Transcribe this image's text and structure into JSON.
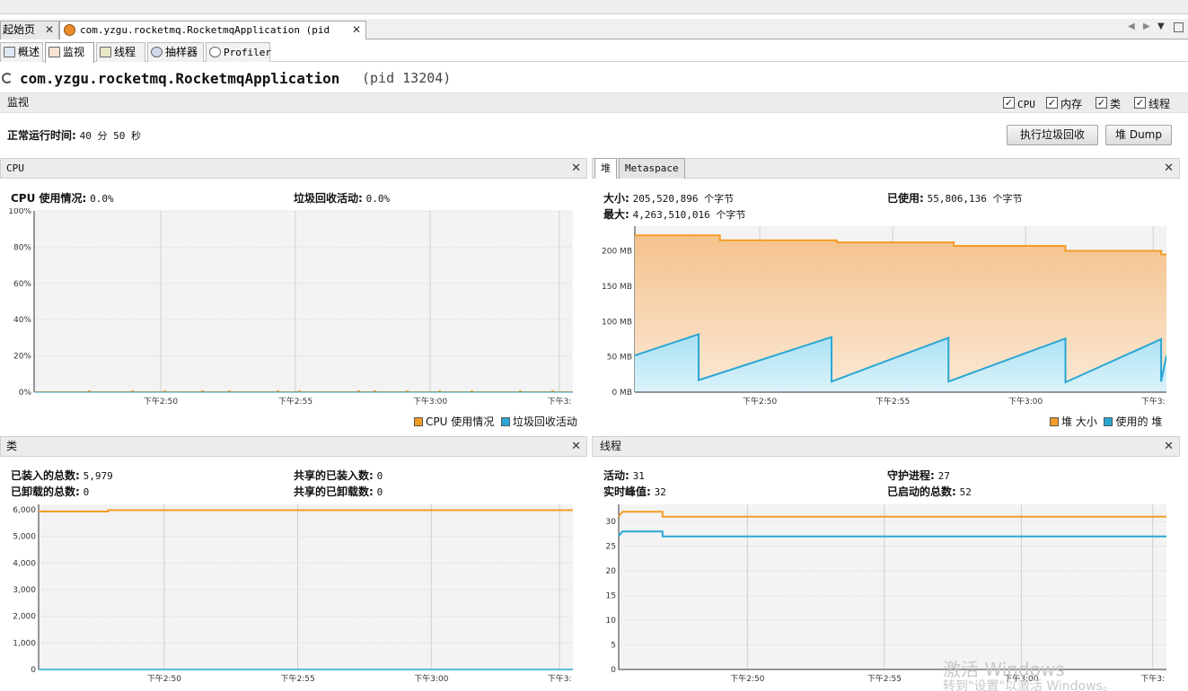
{
  "doc_tabs": [
    {
      "label": "起始页"
    },
    {
      "label": "com.yzgu.rocketmq.RocketmqApplication (pid 13204)"
    }
  ],
  "sub_tabs": [
    {
      "label": "概述"
    },
    {
      "label": "监视"
    },
    {
      "label": "线程"
    },
    {
      "label": "抽样器"
    },
    {
      "label": "Profiler"
    }
  ],
  "page_title": {
    "name": "com.yzgu.rocketmq.RocketmqApplication",
    "pid": "(pid 13204)"
  },
  "monitor": {
    "section_label": "监视",
    "checks": [
      {
        "label": "CPU",
        "checked": true
      },
      {
        "label": "内存",
        "checked": true
      },
      {
        "label": "类",
        "checked": true
      },
      {
        "label": "线程",
        "checked": true
      }
    ],
    "uptime_label": "正常运行时间:",
    "uptime_value": "40 分 50 秒",
    "gc_button": "执行垃圾回收",
    "dump_button": "堆 Dump"
  },
  "cpu_panel": {
    "title": "CPU",
    "usage_label": "CPU 使用情况:",
    "usage_value": "0.0%",
    "gc_label": "垃圾回收活动:",
    "gc_value": "0.0%",
    "legend": [
      "CPU 使用情况",
      "垃圾回收活动"
    ]
  },
  "heap_panel": {
    "tabs": [
      "堆",
      "Metaspace"
    ],
    "size_label": "大小:",
    "size_value": "205,520,896 个字节",
    "max_label": "最大:",
    "max_value": "4,263,510,016 个字节",
    "used_label": "已使用:",
    "used_value": "55,806,136 个字节",
    "legend": [
      "堆 大小",
      "使用的 堆"
    ]
  },
  "class_panel": {
    "title": "类",
    "loaded_label": "已装入的总数:",
    "loaded_value": "5,979",
    "unloaded_label": "已卸载的总数:",
    "unloaded_value": "0",
    "shared_loaded_label": "共享的已装入数:",
    "shared_loaded_value": "0",
    "shared_unloaded_label": "共享的已卸载数:",
    "shared_unloaded_value": "0"
  },
  "thread_panel": {
    "title": "线程",
    "live_label": "活动:",
    "live_value": "31",
    "peak_label": "实时峰值:",
    "peak_value": "32",
    "daemon_label": "守护进程:",
    "daemon_value": "27",
    "started_label": "已启动的总数:",
    "started_value": "52"
  },
  "watermark": {
    "line1": "激活 Windows",
    "line2": "转到\"设置\"以激活 Windows。"
  },
  "colors": {
    "orange": "#f39c26",
    "blue": "#2aa7d4",
    "grid": "#c8c8c8"
  },
  "chart_data": [
    {
      "type": "line",
      "name": "cpu",
      "ylim": [
        0,
        100
      ],
      "yticks": [
        "0%",
        "20%",
        "40%",
        "60%",
        "80%",
        "100%"
      ],
      "ytick_values": [
        0,
        20,
        40,
        60,
        80,
        100
      ],
      "x": [
        "下午2:50",
        "下午2:55",
        "下午3:00",
        "下午3:"
      ],
      "series": [
        {
          "name": "CPU 使用情况",
          "color": "#f39c26",
          "values": [
            0,
            0,
            0,
            0
          ]
        },
        {
          "name": "垃圾回收活动",
          "color": "#2aa7d4",
          "values": [
            0,
            0,
            0,
            0
          ]
        }
      ]
    },
    {
      "type": "area",
      "name": "heap",
      "ylim": [
        0,
        235
      ],
      "yticks": [
        "0 MB",
        "50 MB",
        "100 MB",
        "150 MB",
        "200 MB"
      ],
      "ytick_values": [
        0,
        50,
        100,
        150,
        200
      ],
      "x": [
        "下午2:50",
        "下午2:55",
        "下午3:00",
        "下午3:"
      ],
      "series": [
        {
          "name": "堆 大小",
          "color": "#f39c26",
          "steps": [
            [
              0,
              222
            ],
            [
              0.16,
              215
            ],
            [
              0.38,
              212
            ],
            [
              0.6,
              207
            ],
            [
              0.81,
              200
            ],
            [
              0.99,
              195
            ]
          ]
        },
        {
          "name": "使用的 堆",
          "color": "#2aa7d4",
          "sawtooth": [
            [
              0,
              52
            ],
            [
              0.12,
              82
            ],
            [
              0.12,
              17
            ],
            [
              0.37,
              78
            ],
            [
              0.37,
              15
            ],
            [
              0.59,
              77
            ],
            [
              0.59,
              15
            ],
            [
              0.81,
              76
            ],
            [
              0.81,
              14
            ],
            [
              0.99,
              75
            ],
            [
              0.99,
              15
            ],
            [
              1.2,
              52
            ]
          ]
        }
      ]
    },
    {
      "type": "line",
      "name": "classes",
      "ylim": [
        0,
        6200
      ],
      "yticks": [
        "0",
        "1,000",
        "2,000",
        "3,000",
        "4,000",
        "5,000",
        "6,000"
      ],
      "ytick_values": [
        0,
        1000,
        2000,
        3000,
        4000,
        5000,
        6000
      ],
      "x": [
        "下午2:50",
        "下午2:55",
        "下午3:00",
        "下午3:"
      ],
      "series": [
        {
          "name": "已装入的总数",
          "color": "#f39c26",
          "values": [
            5930,
            5979,
            5979,
            5979
          ]
        },
        {
          "name": "已卸载的总数",
          "color": "#2aa7d4",
          "values": [
            0,
            0,
            0,
            0
          ]
        }
      ]
    },
    {
      "type": "line",
      "name": "threads",
      "ylim": [
        0,
        33.5
      ],
      "yticks": [
        "0",
        "5",
        "10",
        "15",
        "20",
        "25",
        "30"
      ],
      "ytick_values": [
        0,
        5,
        10,
        15,
        20,
        25,
        30
      ],
      "x": [
        "下午2:50",
        "下午2:55",
        "下午3:00",
        "下午3:"
      ],
      "series": [
        {
          "name": "实时峰值",
          "color": "#f39c26",
          "values": [
            32,
            31,
            31,
            31
          ]
        },
        {
          "name": "活动",
          "color": "#2aa7d4",
          "values": [
            28,
            27,
            27,
            27
          ]
        }
      ]
    }
  ]
}
